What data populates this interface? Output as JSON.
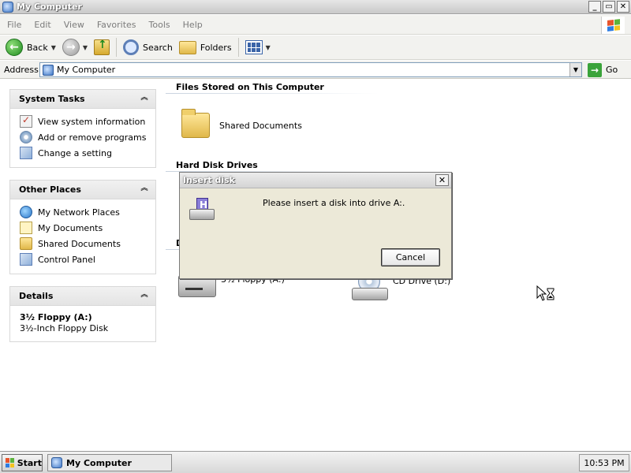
{
  "window": {
    "title": "My Computer"
  },
  "menu": {
    "items": [
      "File",
      "Edit",
      "View",
      "Favorites",
      "Tools",
      "Help"
    ]
  },
  "toolbar": {
    "back_label": "Back",
    "search_label": "Search",
    "folders_label": "Folders"
  },
  "address": {
    "label": "Address",
    "value": "My Computer",
    "go_label": "Go"
  },
  "sidebar": {
    "system_tasks": {
      "title": "System Tasks",
      "items": [
        "View system information",
        "Add or remove programs",
        "Change a setting"
      ]
    },
    "other_places": {
      "title": "Other Places",
      "items": [
        "My Network Places",
        "My Documents",
        "Shared Documents",
        "Control Panel"
      ]
    },
    "details": {
      "title": "Details",
      "name": "3½ Floppy (A:)",
      "description": "3½-Inch Floppy Disk"
    }
  },
  "main": {
    "sections": {
      "files_stored": "Files Stored on This Computer",
      "hard_disk": "Hard Disk Drives",
      "removable": "D"
    },
    "items": {
      "shared_documents": "Shared Documents",
      "floppy": "3½ Floppy (A:)",
      "cd_drive": "CD Drive (D:)"
    }
  },
  "dialog": {
    "title": "Insert disk",
    "message": "Please insert a disk into drive A:.",
    "cancel_label": "Cancel"
  },
  "taskbar": {
    "start_label": "Start",
    "task_label": "My Computer",
    "clock": "10:53 PM"
  },
  "colors": {
    "accent": "#7f9db9",
    "dialog_bg": "#ece9d8"
  }
}
